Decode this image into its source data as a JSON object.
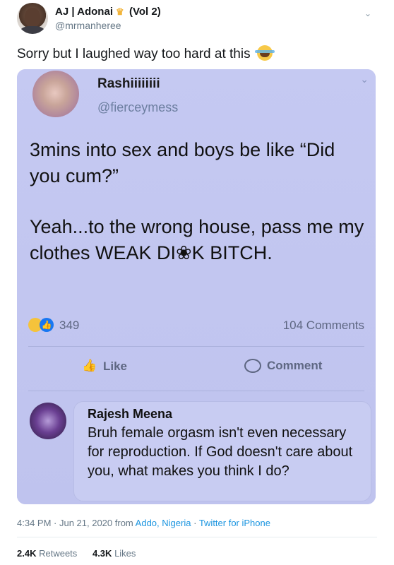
{
  "tweet": {
    "display_name": "AJ | Adonai",
    "name_suffix": "(Vol 2)",
    "handle": "@mrmanheree",
    "text": "Sorry but I laughed way too hard at this",
    "timestamp": "4:34 PM · Jun 21, 2020 from",
    "location": "Addo, Nigeria",
    "separator": "·",
    "client": "Twitter for iPhone",
    "retweets_count": "2.4K",
    "retweets_label": "Retweets",
    "likes_count": "4.3K",
    "likes_label": "Likes"
  },
  "screenshot": {
    "name": "Rashiiiiiiii",
    "handle": "@fierceymess",
    "paragraph_1": "3mins into sex and boys be like “Did you cum?”",
    "paragraph_2": "Yeah...to the wrong house, pass me my clothes WEAK DI❀K BITCH.",
    "reaction_count": "349",
    "comments": "104 Comments",
    "like_label": "Like",
    "comment_label": "Comment",
    "comment_author": "Rajesh Meena",
    "comment_text": "Bruh female orgasm isn't even necessary for reproduction. If God doesn't care about you, what makes you think I do?"
  },
  "icons": {
    "caret": "chevron-down-icon",
    "crown": "crown-icon",
    "emoji": "laughing-emoji-icon"
  },
  "colors": {
    "card_bg": "#c3c7f0",
    "link": "#1b95e0",
    "muted": "#657786"
  }
}
